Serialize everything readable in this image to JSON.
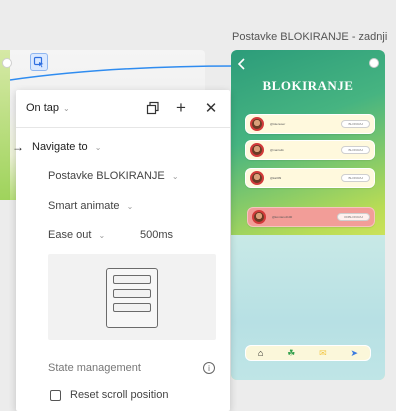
{
  "canvas": {
    "frame_title": "Postavke BLOKIRANJE - zadnji"
  },
  "phone": {
    "title": "BLOKIRANJE",
    "users": [
      {
        "name": "@lolenuser",
        "action": "BLOKIRAJ"
      },
      {
        "name": "@mario4k",
        "action": "BLOKIRAJ"
      },
      {
        "name": "@ka009",
        "action": "BLOKIRAJ"
      }
    ],
    "blocked": {
      "name": "@kontanu3x00",
      "action": "ODBLOKIRAJ"
    },
    "nav_icons": [
      "home-icon",
      "plant-icon",
      "mail-icon",
      "send-icon"
    ],
    "accent_colors": {
      "blocked": "#f29d98",
      "card": "#fff9dd",
      "avatar_ring": "#d23b3b"
    }
  },
  "panel": {
    "trigger": "On tap",
    "action": "Navigate to",
    "destination": "Postavke BLOKIRANJE",
    "animation": "Smart animate",
    "easing": "Ease out",
    "duration": "500ms",
    "state_management_label": "State management",
    "reset_scroll_label": "Reset scroll position",
    "reset_scroll_checked": false
  },
  "colors": {
    "connector": "#2f8cf0",
    "interaction_icon": "#dbe9ff"
  }
}
